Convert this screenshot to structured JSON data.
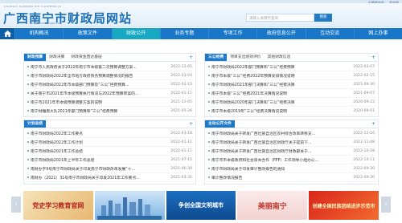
{
  "top_links": [
    "无障碍浏览",
    "手机版"
  ],
  "header": {
    "title": "广西南宁市财政局网站",
    "pinyin": "GUANGXI NANNING SHI CAIZHENG JU",
    "domain": "nncz.nanning.gov.cn",
    "search_placeholder": "请输入关键字查询",
    "search_button": "搜索"
  },
  "nav": {
    "items": [
      "机构概况",
      "政策文件",
      "财政公开",
      "业务专题",
      "专项工作",
      "政府信息公开",
      "互动交流",
      "网上办事"
    ],
    "active_index": 2
  },
  "panels": {
    "budget": {
      "tabs": [
        "财政预算",
        "财政决算",
        "财政资金直达基层"
      ],
      "items": [
        {
          "title": "南宁市人民政府关于2022年南宁市本级第二次预算调整方案...",
          "date": "2022-12-05"
        },
        {
          "title": "南宁市财政局2022年全市地方政府债务预算调整情况的报告",
          "date": "2022-03-04"
        },
        {
          "title": "南宁市财政局2022年市本级部门预算及“三公”经费预算...",
          "date": "2022-02-15"
        },
        {
          "title": "关于南宁市2021年市本级预算执行情况与2022年预算草案的...",
          "date": "2022-01-11"
        },
        {
          "title": "南宁市2021年市本级预算调整方案的说明",
          "date": "2021-11-05"
        },
        {
          "title": "南宁财雕南大队2021年部门预算和“三公”经费预算",
          "date": "2021-05-26"
        }
      ]
    },
    "sangong": {
      "tabs": [
        "三公经费",
        "项目支出绩效评价",
        "其他财政信息"
      ],
      "items": [
        {
          "title": "南宁市财政局2022年部门预算和“三公”经费预算",
          "date": "2022-03-07"
        },
        {
          "title": "南宁市本级“三公”经费2022年预算安排情况说明",
          "date": "2022-02-15"
        },
        {
          "title": "南宁市财政局2021年部门决算和“三公”经费决算",
          "date": "2021-09-30"
        },
        {
          "title": "南宁市本级“三公”经费2021年决算情况说明",
          "date": "2021-09-07"
        },
        {
          "title": "南宁市财政局2020年部门决算和“三公”经费决算",
          "date": "2020-09-22"
        },
        {
          "title": "南宁市本级2019年“三公”经费决算情况说明",
          "date": "2020-09-01"
        }
      ]
    },
    "plan": {
      "tabs": [
        "计划总结"
      ],
      "items": [
        {
          "title": "南宁市财政局2022年工作要点",
          "date": "2022-03-18"
        },
        {
          "title": "南宁市财政局2022年工作计划",
          "date": "2022-01-11"
        },
        {
          "title": "南宁市财政局2021年工作总结",
          "date": "2022-01-11"
        },
        {
          "title": "南宁市财政局2021年上半年工作总结",
          "date": "2021-07-15"
        },
        {
          "title": "南财办字9号南宁市财政局关于印发南宁市财政改革发展“十...",
          "date": "2021-06-30"
        },
        {
          "title": "南财办〔2021〕31号南宁市财政局关于印发2021年工作要点...",
          "date": "2021-03-31"
        }
      ]
    },
    "key_files": {
      "tabs": [
        "主动公开文件"
      ],
      "items": [
        {
          "title": "南宁市财政局关于转发广西壮族自治区农村综合改革转移支...",
          "date": "2022-11-16"
        },
        {
          "title": "南宁市财政局关于转发广西壮族自治区财政厅关于提前下...",
          "date": "2022-11-08"
        },
        {
          "title": "南宁市财政局关于转发广西壮族自治区财政厅财政部关于...",
          "date": "2022-10-28"
        },
        {
          "title": "南宁市市本级政府和社会资本合作（PPP）工作领导小组办公...",
          "date": "2022-10-11"
        },
        {
          "title": "南宁市财政局关于印发审计整改报告的通知",
          "date": "2022-09-30"
        },
        {
          "title": "审计整改情况报告",
          "date": "2022-09-30"
        }
      ]
    }
  },
  "banners": [
    "党史学习教育官网",
    "",
    "争创全国文明城市",
    "美丽南宁",
    "创建全国民族团结进步示范市"
  ]
}
